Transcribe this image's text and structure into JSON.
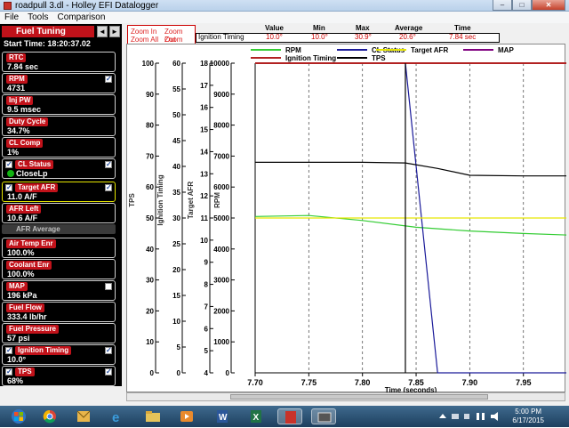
{
  "window": {
    "title": "roadpull 3.dl - Holley EFI Datalogger",
    "buttons": [
      "–",
      "□",
      "✕"
    ]
  },
  "menu": [
    "File",
    "Tools",
    "Comparison"
  ],
  "panel": {
    "title": "Fuel Tuning",
    "start_time": "Start Time: 18:20:37.02",
    "separator": "AFR Average",
    "items": [
      {
        "label": "RTC",
        "value": "7.84 sec",
        "checkbox": "none",
        "checked": false
      },
      {
        "label": "RPM",
        "value": "4731",
        "checkbox": "right",
        "checked": true
      },
      {
        "label": "Inj PW",
        "value": "9.5 msec",
        "checkbox": "none",
        "checked": false
      },
      {
        "label": "Duty Cycle",
        "value": "34.7%",
        "checkbox": "none",
        "checked": false
      },
      {
        "label": "CL Comp",
        "value": "1%",
        "checkbox": "none",
        "checked": false
      },
      {
        "label": "CL Status",
        "value": "CloseLp",
        "checkbox": "both",
        "checked": true
      },
      {
        "label": "Target AFR",
        "value": "11.0 A/F",
        "checkbox": "both",
        "checked": true
      },
      {
        "label": "AFR Left",
        "value": "10.6 A/F",
        "checkbox": "none",
        "checked": false
      },
      {
        "label": "Air Temp Enr",
        "value": "100.0%",
        "checkbox": "none",
        "checked": false
      },
      {
        "label": "Coolant Enr",
        "value": "100.0%",
        "checkbox": "none",
        "checked": false
      },
      {
        "label": "MAP",
        "value": "196 kPa",
        "checkbox": "right",
        "checked": false
      },
      {
        "label": "Fuel Flow",
        "value": "333.4 lb/hr",
        "checkbox": "none",
        "checked": false
      },
      {
        "label": "Fuel Pressure",
        "value": "57 psi",
        "checkbox": "none",
        "checked": false
      },
      {
        "label": "Ignition Timing",
        "value": "10.0°",
        "checkbox": "both",
        "checked": true
      },
      {
        "label": "TPS",
        "value": "68%",
        "checkbox": "both",
        "checked": true
      }
    ]
  },
  "zoom": {
    "in": "Zoom In",
    "out": "Zoom Out",
    "all": "Zoom All",
    "last": "Zoom Last"
  },
  "stats": {
    "headers": [
      "Value",
      "Min",
      "Max",
      "Average",
      "Time"
    ],
    "row_label": "Ignition Timing",
    "values": [
      "10.0°",
      "10.0°",
      "30.9°",
      "20.6°",
      "7.84 sec"
    ]
  },
  "legend": [
    {
      "name": "RPM",
      "color": "#33cc33"
    },
    {
      "name": "CL Status",
      "color": "#1a1a99"
    },
    {
      "name": "Target AFR",
      "color": "#e6e600"
    },
    {
      "name": "MAP",
      "color": "#800080"
    },
    {
      "name": "Ignition Timing",
      "color": "#b22222"
    },
    {
      "name": "TPS",
      "color": "#000000"
    }
  ],
  "chart_data": {
    "type": "line",
    "xlabel": "Time (seconds)",
    "xlim": [
      7.7,
      7.99
    ],
    "x_ticks": [
      "7.70",
      "7.75",
      "7.80",
      "7.85",
      "7.90",
      "7.95"
    ],
    "y_axes": [
      {
        "label": "TPS",
        "ticks": [
          "100",
          "90",
          "80",
          "70",
          "60",
          "50",
          "40",
          "30",
          "20",
          "10",
          "0"
        ]
      },
      {
        "label": "Ignition Timing",
        "ticks": [
          "60",
          "55",
          "50",
          "45",
          "40",
          "35",
          "30",
          "25",
          "20",
          "15",
          "10",
          "5",
          "0"
        ]
      },
      {
        "label": "Target AFR",
        "ticks": [
          "18",
          "17",
          "16",
          "15",
          "14",
          "13",
          "12",
          "11",
          "10",
          "9",
          "8",
          "7",
          "6",
          "5",
          "4"
        ]
      },
      {
        "label": "RPM",
        "ticks": [
          "10000",
          "9000",
          "8000",
          "7000",
          "6000",
          "5000",
          "4000",
          "3000",
          "2000",
          "1000",
          "0"
        ]
      }
    ],
    "cursor_x": 7.84,
    "series": [
      {
        "name": "RPM",
        "x": [
          7.7,
          7.75,
          7.8,
          7.85,
          7.9,
          7.95,
          7.99
        ],
        "values": [
          5050,
          5080,
          4920,
          4700,
          4580,
          4500,
          4450
        ]
      },
      {
        "name": "CL Status",
        "x": [
          7.7,
          7.84,
          7.87,
          7.99
        ],
        "values": [
          10000,
          10000,
          0,
          0
        ]
      },
      {
        "name": "Target AFR",
        "x": [
          7.7,
          7.99
        ],
        "values": [
          11.0,
          11.0
        ]
      },
      {
        "name": "Ignition Timing",
        "x": [
          7.7,
          7.99
        ],
        "values": [
          60,
          60
        ]
      },
      {
        "name": "TPS",
        "x": [
          7.7,
          7.8,
          7.84,
          7.87,
          7.9,
          7.95,
          7.99
        ],
        "values": [
          68,
          68,
          67.8,
          66,
          63.8,
          63.6,
          63.6
        ]
      }
    ]
  },
  "taskbar": {
    "time": "5:00 PM",
    "date": "6/17/2015"
  }
}
